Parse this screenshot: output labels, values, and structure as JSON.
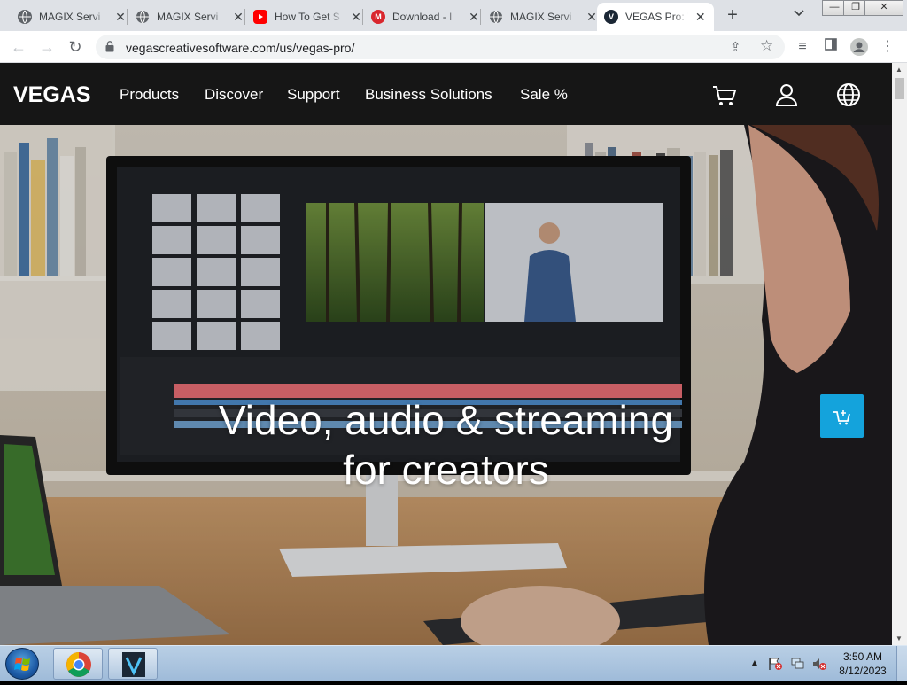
{
  "browser": {
    "tabs": [
      {
        "title": "MAGIX Servi",
        "favicon": "globe-icon",
        "active": false
      },
      {
        "title": "MAGIX Servi",
        "favicon": "globe-icon",
        "active": false
      },
      {
        "title": "How To Get S",
        "favicon": "youtube-icon",
        "active": false
      },
      {
        "title": "Download - I",
        "favicon": "mega-icon",
        "active": false
      },
      {
        "title": "MAGIX Servi",
        "favicon": "globe-icon",
        "active": false
      },
      {
        "title": "VEGAS Pro: V",
        "favicon": "vegas-icon",
        "active": true
      }
    ],
    "new_tab": "+",
    "url": "vegascreativesoftware.com/us/vegas-pro/"
  },
  "site": {
    "logo": "VEGAS",
    "nav": [
      "Products",
      "Discover",
      "Support",
      "Business Solutions",
      "Sale %"
    ],
    "headline_line1": "Video, audio & streaming",
    "headline_line2": "for creators",
    "accent_color": "#14a3dc"
  },
  "taskbar": {
    "time": "3:50 AM",
    "date": "8/12/2023",
    "pinned": [
      "chrome-icon",
      "vegas-pro-icon"
    ]
  }
}
